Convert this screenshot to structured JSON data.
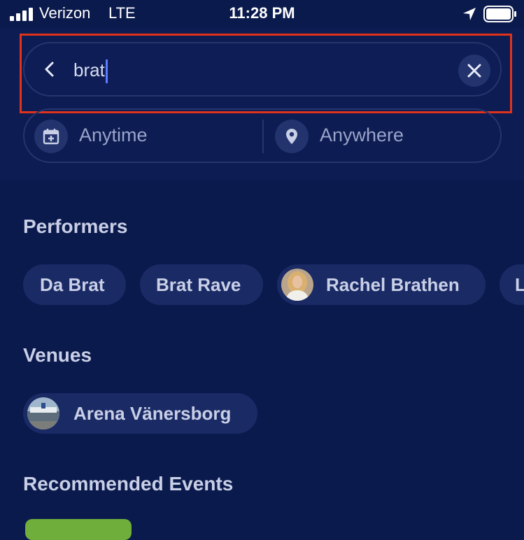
{
  "status_bar": {
    "carrier": "Verizon",
    "network": "LTE",
    "time": "11:28 PM",
    "icons": [
      "signal-icon",
      "location-arrow-icon",
      "battery-icon"
    ]
  },
  "search": {
    "query": "brat",
    "back_icon": "chevron-left-icon",
    "clear_icon": "close-icon"
  },
  "filters": {
    "date_label": "Anytime",
    "date_icon": "calendar-plus-icon",
    "location_label": "Anywhere",
    "location_icon": "map-pin-icon"
  },
  "performers": {
    "heading": "Performers",
    "items": [
      {
        "label": "Da Brat"
      },
      {
        "label": "Brat Rave"
      },
      {
        "label": "Rachel Brathen"
      },
      {
        "label": "L"
      }
    ]
  },
  "venues": {
    "heading": "Venues",
    "items": [
      {
        "label": "Arena Vänersborg"
      }
    ]
  },
  "recommended": {
    "heading": "Recommended Events"
  },
  "colors": {
    "background": "#0b1a4d",
    "chip": "#1a2a65",
    "highlight": "#e0331b",
    "caret": "#5b7cff"
  }
}
